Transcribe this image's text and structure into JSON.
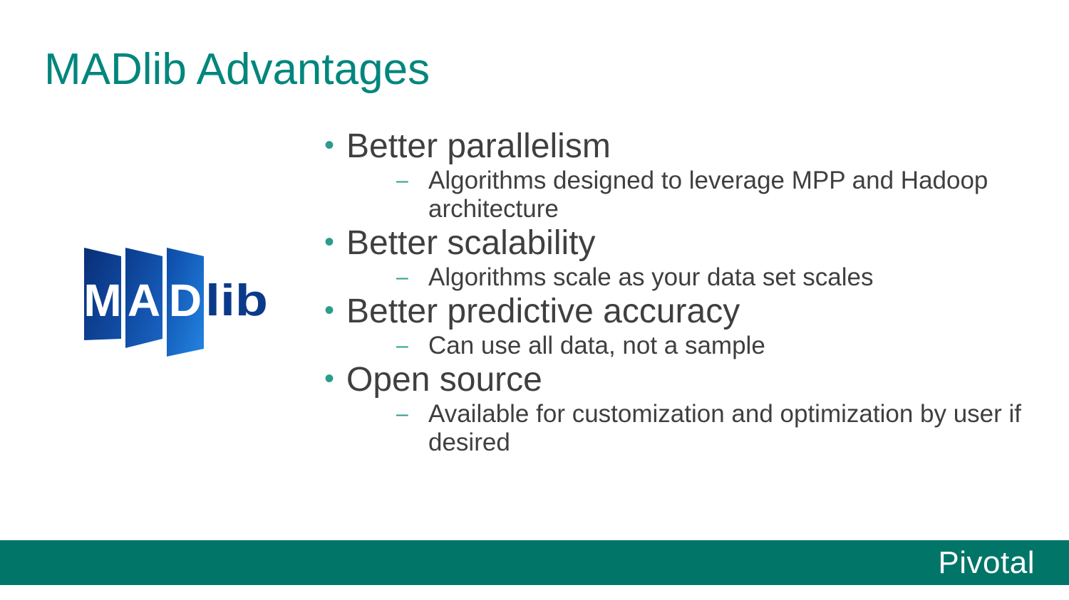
{
  "slide": {
    "title": "MADlib Advantages",
    "bullets": [
      {
        "text": "Better parallelism",
        "subs": [
          "Algorithms designed to leverage MPP and Hadoop architecture"
        ]
      },
      {
        "text": "Better scalability",
        "subs": [
          "Algorithms scale as your data set scales"
        ]
      },
      {
        "text": "Better predictive accuracy",
        "subs": [
          "Can use all data, not a sample"
        ]
      },
      {
        "text": "Open source",
        "subs": [
          "Available for customization and optimization by user if desired"
        ]
      }
    ]
  },
  "logo": {
    "name": "madlib-logo",
    "letters": [
      "M",
      "A",
      "D"
    ],
    "suffix": "lib"
  },
  "footer": {
    "brand": "Pivotal"
  },
  "colors": {
    "title": "#00867d",
    "bullet_dot": "#2b9c8d",
    "body_text": "#3f3f3f",
    "footer_bar": "#027569",
    "footer_text": "#ffffff",
    "logo_blue_dark": "#0b3a8a",
    "logo_blue_light": "#1e77d8"
  }
}
